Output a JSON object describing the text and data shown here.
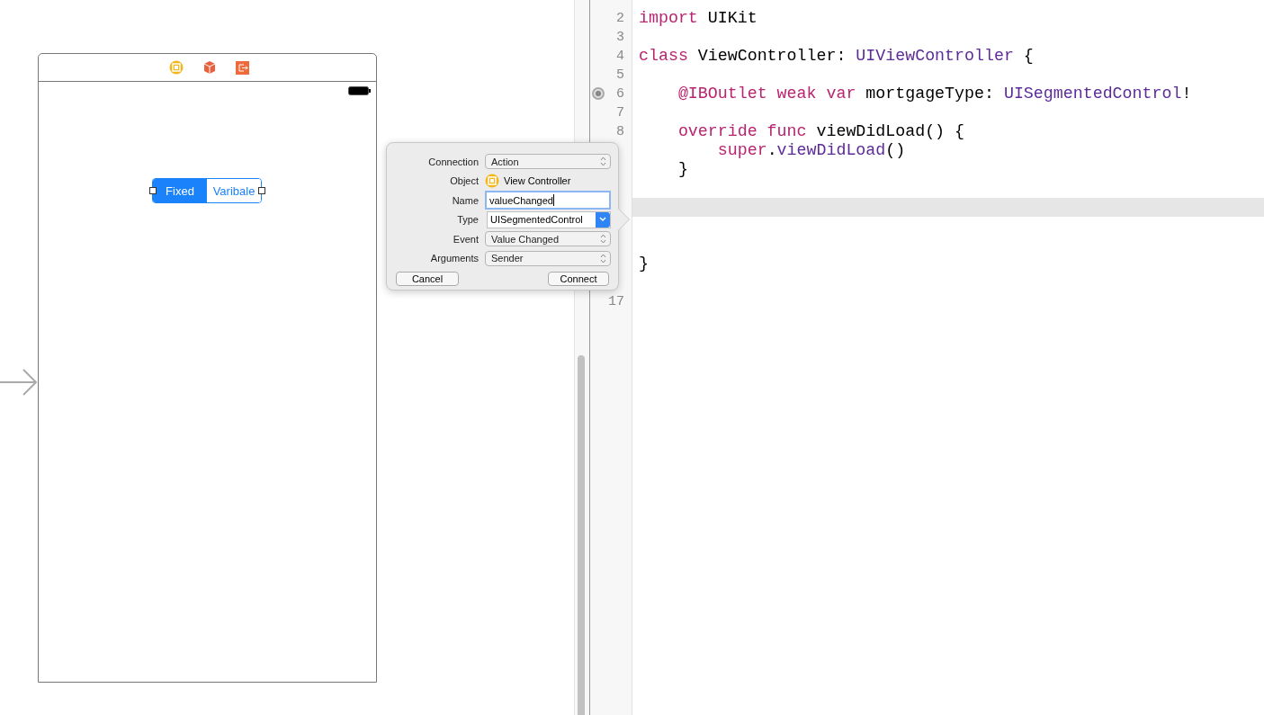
{
  "scene": {
    "segments": [
      {
        "label": "Fixed",
        "selected": true
      },
      {
        "label": "Varibale",
        "selected": false
      }
    ]
  },
  "popover": {
    "rows": [
      {
        "label": "Connection",
        "kind": "popup",
        "value": "Action"
      },
      {
        "label": "Object",
        "kind": "object",
        "value": "View Controller"
      },
      {
        "label": "Name",
        "kind": "field",
        "value": "valueChanged"
      },
      {
        "label": "Type",
        "kind": "combo",
        "value": "UISegmentedControl"
      },
      {
        "label": "Event",
        "kind": "popup",
        "value": "Value Changed"
      },
      {
        "label": "Arguments",
        "kind": "popup",
        "value": "Sender"
      }
    ],
    "buttons": [
      "Cancel",
      "Connect"
    ]
  },
  "editor": {
    "lines": [
      {
        "number": "2",
        "current": false,
        "connected": false,
        "tokens": [
          {
            "t": "import",
            "kind": "keyword"
          },
          {
            "t": " UIKit",
            "kind": "plain"
          }
        ]
      },
      {
        "number": "3",
        "current": false,
        "connected": false
      },
      {
        "number": "4",
        "current": false,
        "connected": false,
        "tokens": [
          {
            "t": "class",
            "kind": "keyword"
          },
          {
            "t": " ViewController: ",
            "kind": "plain"
          },
          {
            "t": "UIViewController",
            "kind": "type"
          },
          {
            "t": " {",
            "kind": "plain"
          }
        ]
      },
      {
        "number": "5",
        "current": false,
        "connected": false
      },
      {
        "number": "6",
        "current": false,
        "connected": true,
        "tokens": [
          {
            "t": "    @IBOutlet weak var",
            "kind": "keyword"
          },
          {
            "t": " mortgageType: ",
            "kind": "plain"
          },
          {
            "t": "UISegmentedControl",
            "kind": "type"
          },
          {
            "t": "!",
            "kind": "plain"
          }
        ]
      },
      {
        "number": "7",
        "current": false,
        "connected": false
      },
      {
        "number": "8",
        "current": false,
        "connected": false,
        "tokens": [
          {
            "t": "    override func",
            "kind": "keyword"
          },
          {
            "t": " viewDidLoad() {",
            "kind": "plain"
          }
        ]
      },
      {
        "current": false,
        "connected": false,
        "tokens": [
          {
            "t": "        super",
            "kind": "keyword"
          },
          {
            "t": ".",
            "kind": "plain"
          },
          {
            "t": "viewDidLoad",
            "kind": "type"
          },
          {
            "t": "()",
            "kind": "plain"
          }
        ]
      },
      {
        "current": false,
        "connected": false,
        "tokens": [
          {
            "t": "    }",
            "kind": "plain"
          }
        ]
      },
      {
        "current": false,
        "connected": false
      },
      {
        "current": true,
        "connected": false
      },
      {
        "current": false,
        "connected": false
      },
      {
        "current": false,
        "connected": false
      },
      {
        "current": false,
        "connected": false,
        "tokens": [
          {
            "t": "}",
            "kind": "plain"
          }
        ]
      },
      {
        "current": false,
        "connected": false
      },
      {
        "number": "17",
        "current": false,
        "connected": false
      }
    ]
  }
}
